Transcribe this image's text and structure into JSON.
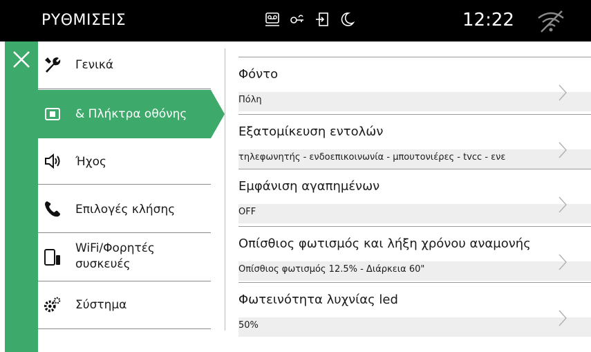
{
  "header": {
    "title": "ΡΥΘΜΙΣΕΙΣ",
    "time": "12:22",
    "status_icons": [
      "answering-machine-icon",
      "door-key-icon",
      "door-exit-icon",
      "moon-icon"
    ],
    "wifi_icon": "wifi-off-icon"
  },
  "colors": {
    "accent": "#3daa6b",
    "topbar": "#000000",
    "value_bg": "#eeeeee"
  },
  "sidebar": {
    "close_icon": "close-icon",
    "items": [
      {
        "label": "Γενικά",
        "icon": "wrench-icon"
      },
      {
        "label": "& Πλήκτρα οθόνης",
        "icon": "display-icon",
        "active": true
      },
      {
        "label": "Ήχος",
        "icon": "speaker-icon"
      },
      {
        "label": "Επιλογές κλήσης",
        "icon": "phone-icon"
      },
      {
        "label_line1": "WiFi/Φορητές",
        "label_line2": "συσκευές",
        "icon": "devices-icon"
      },
      {
        "label": "Σύστημα",
        "icon": "gears-icon"
      }
    ]
  },
  "settings": [
    {
      "title": "Φόντο",
      "value": "Πόλη"
    },
    {
      "title": "Εξατομίκευση εντολών",
      "value": "τηλεφωνητής - ενδοεπικοινωνία - μπουτονιέρες - tvcc - ενε"
    },
    {
      "title": "Εμφάνιση αγαπημένων",
      "value": "OFF"
    },
    {
      "title": "Οπίσθιος φωτισμός και λήξη χρόνου αναμονής",
      "value": "Οπίσθιος φωτισμός 12.5%  -  Διάρκεια 60\""
    },
    {
      "title": "Φωτεινότητα λυχνίας led",
      "value": "50%"
    }
  ]
}
